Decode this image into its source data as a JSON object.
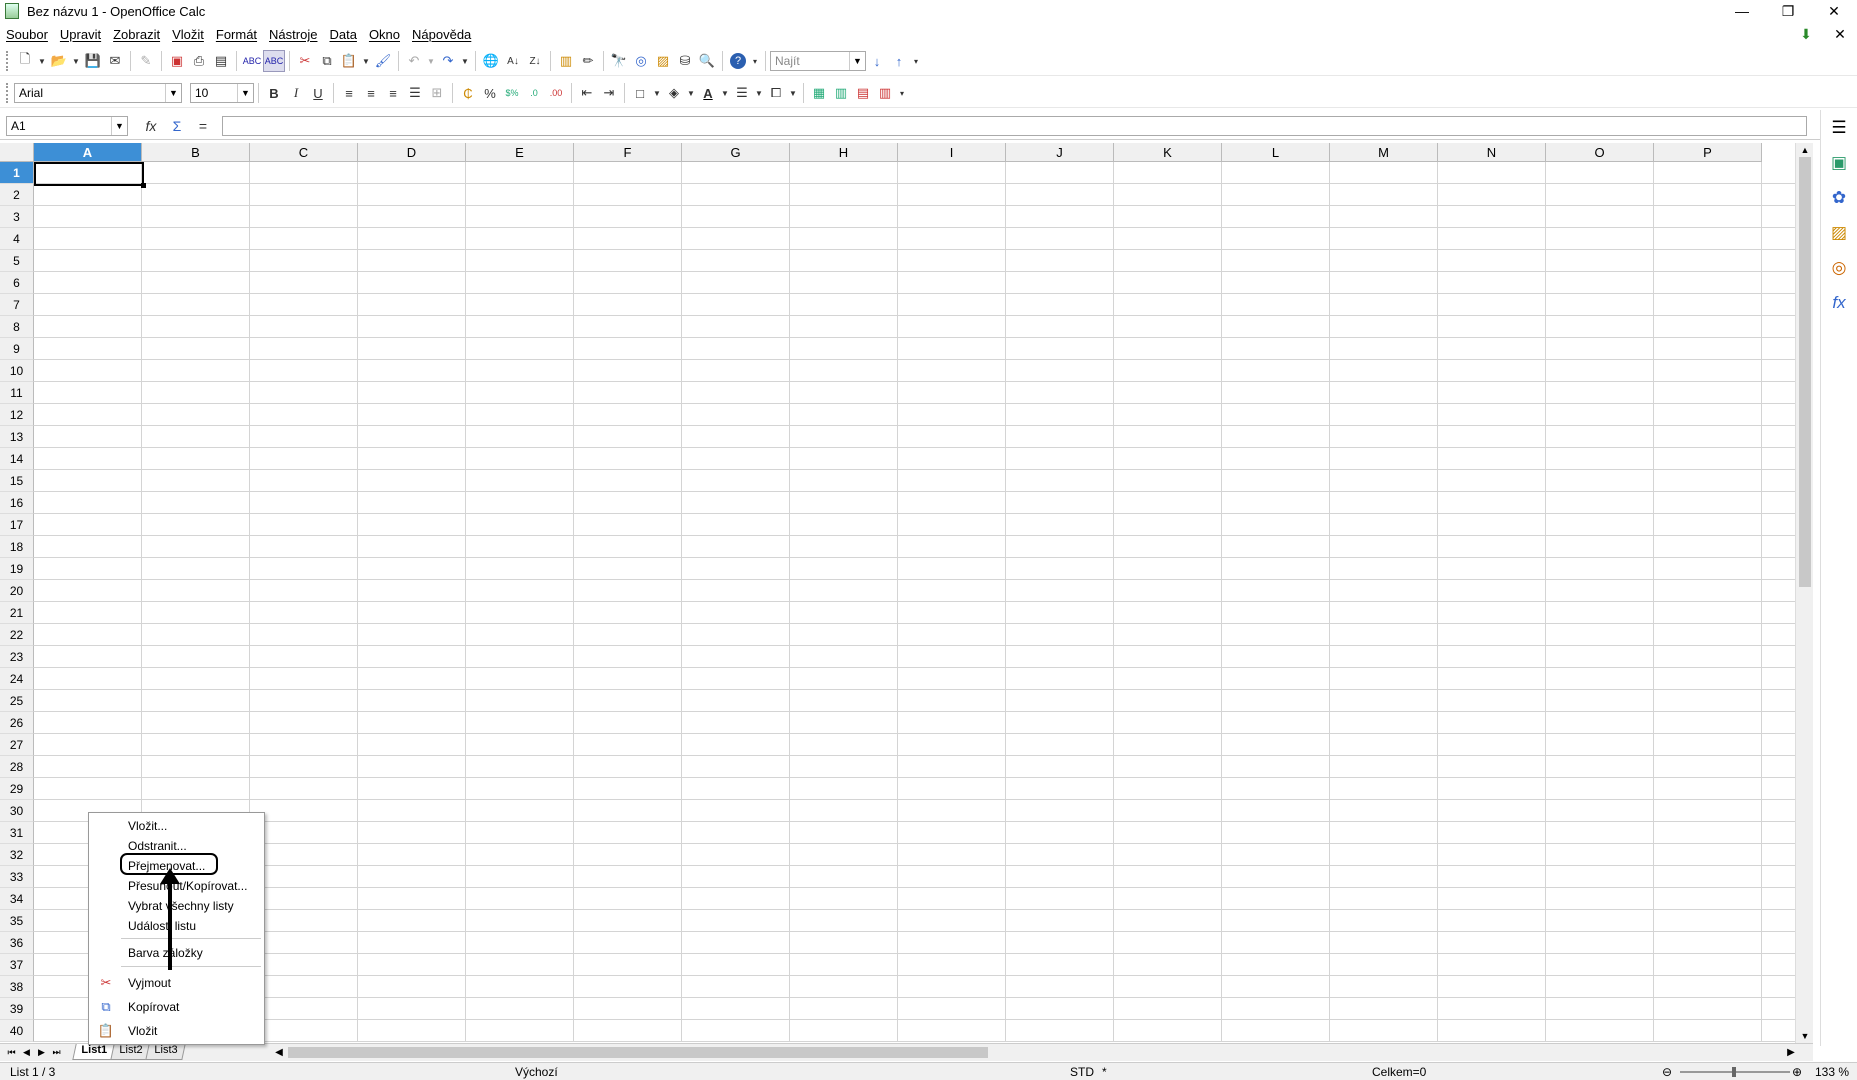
{
  "window": {
    "title": "Bez názvu 1 - OpenOffice Calc",
    "minimize": "—",
    "restore": "❐",
    "close": "✕"
  },
  "menubar": {
    "items": [
      "Soubor",
      "Upravit",
      "Zobrazit",
      "Vložit",
      "Formát",
      "Nástroje",
      "Data",
      "Okno",
      "Nápověda"
    ],
    "update_icon": "⬇",
    "close_doc": "✕"
  },
  "standard_toolbar": {
    "find_placeholder": "Najít",
    "icons": [
      "new-icon",
      "open-icon",
      "save-icon",
      "email-icon",
      "edit-file-icon",
      "export-pdf-icon",
      "print-icon",
      "page-preview-icon",
      "spellcheck-icon",
      "autospell-icon",
      "cut-icon",
      "copy-icon",
      "paste-icon",
      "clone-format-icon",
      "undo-icon",
      "redo-icon",
      "hyperlink-icon",
      "sort-asc-icon",
      "sort-desc-icon",
      "chart-icon",
      "draw-icon",
      "find-replace-icon",
      "navigator-icon",
      "gallery-icon",
      "datasources-icon",
      "zoom-icon",
      "help-icon"
    ]
  },
  "format_toolbar": {
    "font_name": "Arial",
    "font_size": "10"
  },
  "formula_bar": {
    "cell_ref": "A1",
    "wizard_glyph": "fx",
    "sum_glyph": "Σ",
    "equals_glyph": "=",
    "content": ""
  },
  "sheet": {
    "columns": [
      "A",
      "B",
      "C",
      "D",
      "E",
      "F",
      "G",
      "H",
      "I",
      "J",
      "K",
      "L",
      "M",
      "N",
      "O",
      "P"
    ],
    "rows": [
      "1",
      "2",
      "3",
      "4",
      "5",
      "6",
      "7",
      "8",
      "9",
      "10",
      "11",
      "12",
      "13",
      "14",
      "15",
      "16",
      "17",
      "18",
      "19",
      "20",
      "21",
      "22",
      "23",
      "24",
      "25",
      "26",
      "27",
      "28",
      "29",
      "30",
      "31",
      "32",
      "33",
      "34",
      "35",
      "36",
      "37",
      "38",
      "39",
      "40"
    ],
    "selected_column": "A",
    "selected_row": "1"
  },
  "sheet_tabs": [
    "List1",
    "List2",
    "List3"
  ],
  "active_tab": "List1",
  "context_menu": {
    "items": [
      {
        "label": "Vložit..."
      },
      {
        "label": "Odstranit..."
      },
      {
        "label": "Přejmenovat..."
      },
      {
        "label": "Přesunout/Kopírovat..."
      },
      {
        "label": "Vybrat všechny listy"
      },
      {
        "label": "Události listu"
      },
      {
        "label": "Barva záložky"
      },
      {
        "label": "Vyjmout",
        "icon": "cut-icon"
      },
      {
        "label": "Kopírovat",
        "icon": "copy-icon"
      },
      {
        "label": "Vložit",
        "icon": "paste-icon"
      }
    ],
    "highlighted": "Přejmenovat..."
  },
  "statusbar": {
    "sheet_info": "List 1 / 3",
    "page_style": "Výchozí",
    "mode": "STD",
    "modified": "*",
    "sum": "Celkem=0",
    "zoom": "133 %"
  }
}
